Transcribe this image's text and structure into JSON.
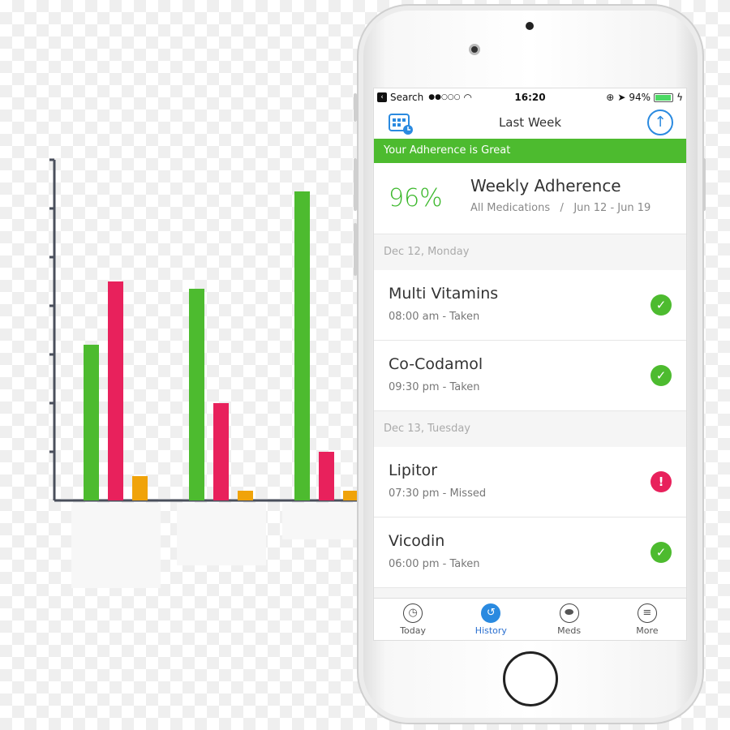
{
  "chart_data": {
    "type": "bar",
    "categories": [
      "",
      "",
      ""
    ],
    "series": [
      {
        "color": "#4dbb2f",
        "values": [
          3.2,
          4.35,
          6.35
        ]
      },
      {
        "color": "#e8215c",
        "values": [
          4.5,
          2.0,
          1.0
        ]
      },
      {
        "color": "#f0a30a",
        "values": [
          0.5,
          0.2,
          0.2
        ]
      }
    ],
    "ylim": [
      0,
      7
    ],
    "grid": false
  },
  "status": {
    "back": "Search",
    "signal": "●●○○○",
    "time": "16:20",
    "battery": "94%"
  },
  "nav": {
    "title": "Last Week"
  },
  "banner": "Your Adherence is Great",
  "summary": {
    "percent": "96%",
    "title": "Weekly Adherence",
    "filter": "All Medications",
    "separator": "/",
    "range": "Jun 12 - Jun 19"
  },
  "days": [
    {
      "header": "Dec 12, Monday",
      "meds": [
        {
          "name": "Multi Vitamins",
          "time": "08:00 am - Taken",
          "status": "taken"
        },
        {
          "name": "Co-Codamol",
          "time": "09:30 pm - Taken",
          "status": "taken"
        }
      ]
    },
    {
      "header": "Dec 13, Tuesday",
      "meds": [
        {
          "name": "Lipitor",
          "time": "07:30 pm - Missed",
          "status": "missed"
        },
        {
          "name": "Vicodin",
          "time": "06:00 pm - Taken",
          "status": "taken"
        }
      ]
    }
  ],
  "tabs": [
    {
      "label": "Today",
      "icon": "clock-icon"
    },
    {
      "label": "History",
      "icon": "history-icon"
    },
    {
      "label": "Meds",
      "icon": "pill-icon"
    },
    {
      "label": "More",
      "icon": "menu-icon"
    }
  ],
  "colors": {
    "green": "#4dbb2f",
    "red": "#e8215c",
    "blue": "#2a8ae0"
  }
}
